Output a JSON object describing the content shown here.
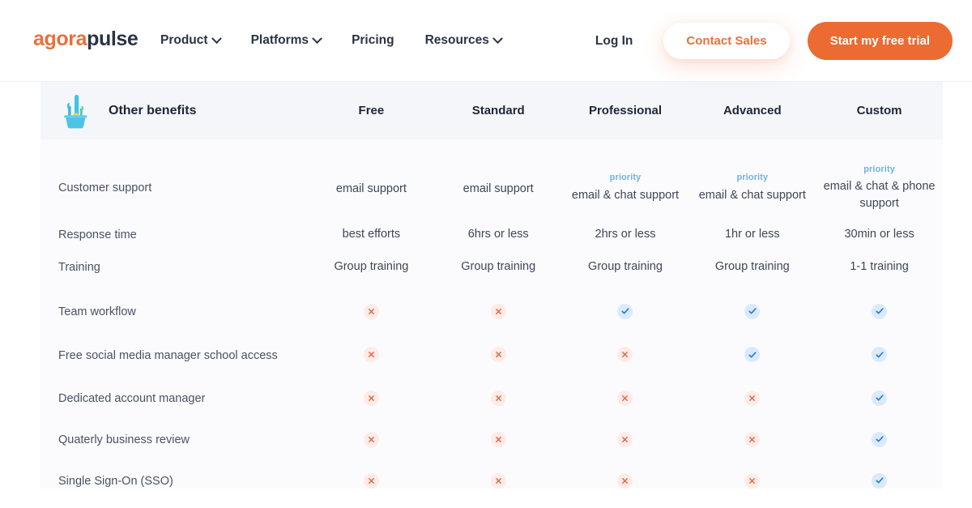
{
  "header": {
    "logo": {
      "first": "agora",
      "second": "pulse"
    },
    "nav": [
      {
        "label": "Product",
        "has_caret": true
      },
      {
        "label": "Platforms",
        "has_caret": true
      },
      {
        "label": "Pricing",
        "has_caret": false
      },
      {
        "label": "Resources",
        "has_caret": true
      }
    ],
    "login_label": "Log In",
    "contact_label": "Contact Sales",
    "trial_label": "Start my free trial",
    "colors": {
      "brand_orange": "#ec6b33",
      "logo_orange": "#e8703a",
      "navy": "#2b3445"
    }
  },
  "table": {
    "section_title": "Other benefits",
    "section_icon": "cactus-plant-icon",
    "columns": [
      "Free",
      "Standard",
      "Professional",
      "Advanced",
      "Custom"
    ],
    "rows": [
      {
        "label": "Customer support",
        "type": "text",
        "cells": [
          {
            "priority": "",
            "text": "email support"
          },
          {
            "priority": "",
            "text": "email support"
          },
          {
            "priority": "priority",
            "text": "email & chat support"
          },
          {
            "priority": "priority",
            "text": "email & chat support"
          },
          {
            "priority": "priority",
            "text": "email & chat & phone support"
          }
        ]
      },
      {
        "label": "Response time",
        "type": "text",
        "cells": [
          {
            "priority": "",
            "text": "best efforts"
          },
          {
            "priority": "",
            "text": "6hrs or less"
          },
          {
            "priority": "",
            "text": "2hrs or less"
          },
          {
            "priority": "",
            "text": "1hr or less"
          },
          {
            "priority": "",
            "text": "30min or less"
          }
        ]
      },
      {
        "label": "Training",
        "type": "text",
        "cells": [
          {
            "priority": "",
            "text": "Group training"
          },
          {
            "priority": "",
            "text": "Group training"
          },
          {
            "priority": "",
            "text": "Group training"
          },
          {
            "priority": "",
            "text": "Group training"
          },
          {
            "priority": "",
            "text": "1-1 training"
          }
        ]
      },
      {
        "label": "Team workflow",
        "type": "icon",
        "values": [
          "no",
          "no",
          "yes",
          "yes",
          "yes"
        ]
      },
      {
        "label": "Free social media manager school access",
        "type": "icon",
        "values": [
          "no",
          "no",
          "no",
          "yes",
          "yes"
        ]
      },
      {
        "label": "Dedicated account manager",
        "type": "icon",
        "values": [
          "no",
          "no",
          "no",
          "no",
          "yes"
        ]
      },
      {
        "label": "Quaterly business review",
        "type": "icon",
        "values": [
          "no",
          "no",
          "no",
          "no",
          "yes"
        ]
      },
      {
        "label": "Single Sign-On (SSO)",
        "type": "icon",
        "values": [
          "no",
          "no",
          "no",
          "no",
          "yes"
        ]
      }
    ],
    "icon_names": {
      "yes": "check-icon",
      "no": "cross-icon"
    },
    "colors": {
      "header_bg": "#f4f6fa",
      "body_bg": "#fbfbfd",
      "yes_badge": "#dbeafb",
      "yes_mark": "#2f7fd1",
      "no_badge": "#fdece6",
      "no_mark": "#e2654a",
      "priority_text": "#6fb3e0"
    }
  }
}
